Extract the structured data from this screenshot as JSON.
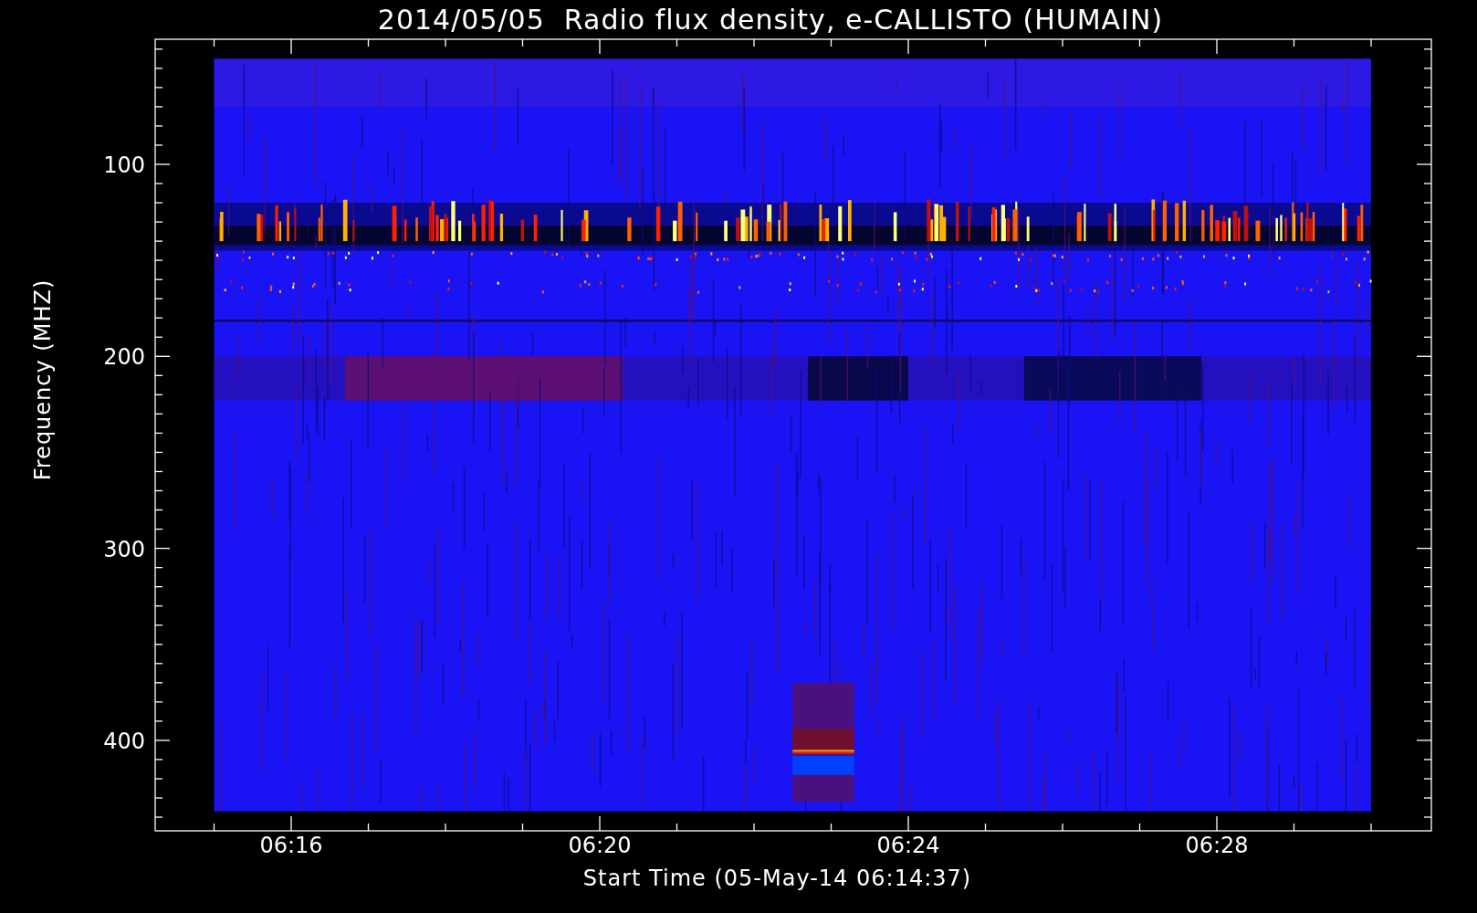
{
  "title": "2014/05/05  Radio flux density, e-CALLISTO (HUMAIN)",
  "y_axis": {
    "label": "Frequency (MHZ)",
    "ticks": [
      "100",
      "200",
      "300",
      "400"
    ]
  },
  "x_axis": {
    "label": "Start Time (05-May-14 06:14:37)",
    "ticks": [
      "06:16",
      "06:20",
      "06:24",
      "06:28"
    ]
  }
}
